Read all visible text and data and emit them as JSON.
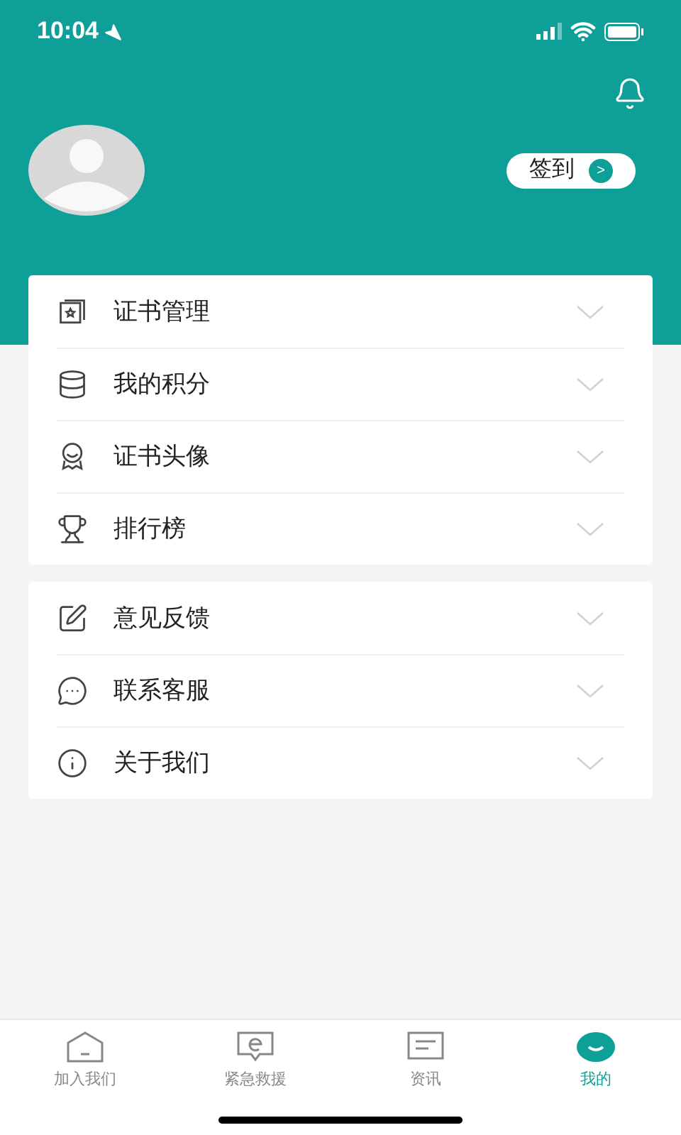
{
  "status_bar": {
    "time": "10:04"
  },
  "header": {
    "sign_in": {
      "label": "签到",
      "arrow": ">"
    }
  },
  "menu_groups": [
    {
      "items": [
        {
          "kind": "certificate",
          "label": "证书管理",
          "expanded": false
        },
        {
          "kind": "points",
          "label": "我的积分",
          "expanded": false
        },
        {
          "kind": "avatar",
          "label": "证书头像",
          "expanded": false
        },
        {
          "kind": "ranking",
          "label": "排行榜",
          "expanded": false
        }
      ]
    },
    {
      "items": [
        {
          "kind": "feedback",
          "label": "意见反馈",
          "expanded": false
        },
        {
          "kind": "service",
          "label": "联系客服",
          "expanded": false
        },
        {
          "kind": "about",
          "label": "关于我们",
          "expanded": false
        }
      ]
    }
  ],
  "tab_bar": [
    {
      "kind": "join",
      "label": "加入我们",
      "selected": false
    },
    {
      "kind": "rescue",
      "label": "紧急救援",
      "selected": false
    },
    {
      "kind": "news",
      "label": "资讯",
      "selected": false
    },
    {
      "kind": "mine",
      "label": "我的",
      "selected": true
    }
  ]
}
